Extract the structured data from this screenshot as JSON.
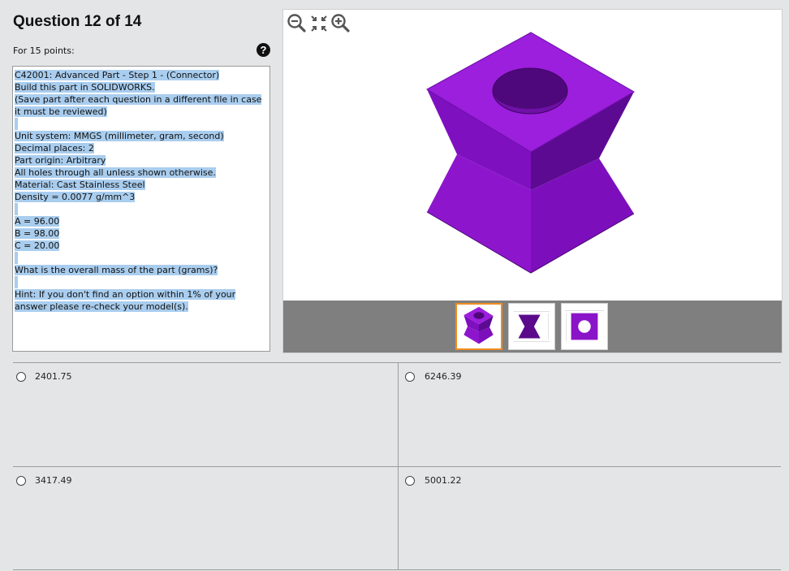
{
  "header": {
    "title": "Question 12 of 14",
    "points_label": "For 15 points:",
    "help_icon": "question-circle-icon",
    "help_glyph": "?"
  },
  "question": {
    "lines": [
      "C42001:  Advanced Part - Step 1 - (Connector)",
      "Build this part in SOLIDWORKS.",
      "(Save part after each question in a different file in case it must be reviewed)",
      "",
      "Unit system: MMGS (millimeter, gram, second)",
      "Decimal places: 2",
      "Part origin: Arbitrary",
      "All holes through all unless shown otherwise.",
      "Material: Cast Stainless Steel",
      "Density = 0.0077 g/mm^3",
      "",
      "A = 96.00",
      "B = 98.00",
      "C = 20.00",
      "",
      "What is the overall mass of the part (grams)?",
      "",
      "Hint: If you don't find an option within 1% of your answer please re-check your model(s)."
    ]
  },
  "viewer": {
    "tools": [
      "zoom-out-icon",
      "fit-to-view-icon",
      "zoom-in-icon"
    ],
    "thumbnails": [
      {
        "name": "isometric-view-thumbnail",
        "active": true
      },
      {
        "name": "front-view-thumbnail",
        "active": false
      },
      {
        "name": "top-view-thumbnail",
        "active": false
      }
    ],
    "colors": {
      "part_purple": "#9b1fdc",
      "part_dark": "#5c0c8c",
      "active_thumb_border": "#ee8c21",
      "selection_highlight": "#a9cdee"
    }
  },
  "answers": [
    {
      "label": "2401.75",
      "selected": false
    },
    {
      "label": "6246.39",
      "selected": false
    },
    {
      "label": "3417.49",
      "selected": false
    },
    {
      "label": "5001.22",
      "selected": false
    }
  ]
}
